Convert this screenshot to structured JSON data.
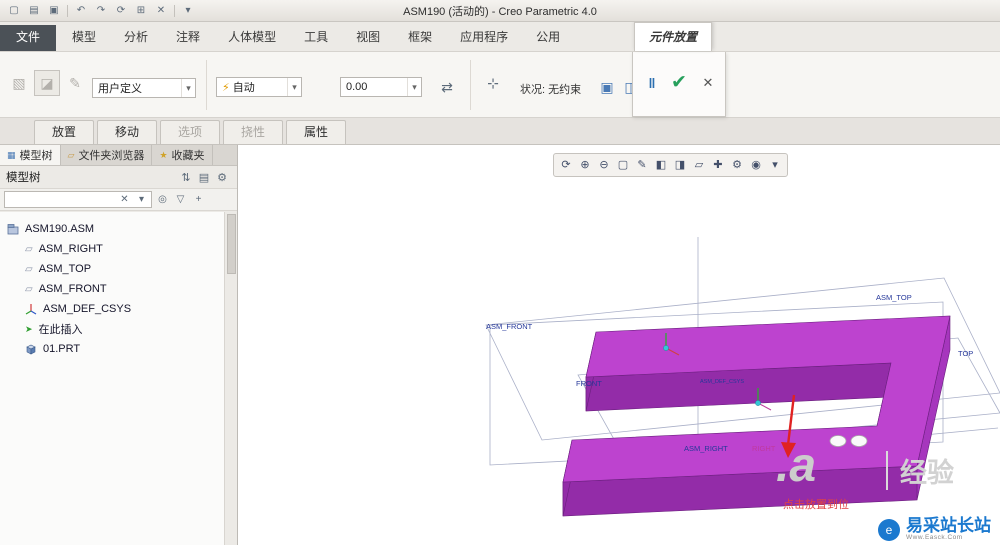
{
  "titlebar": {
    "title": "ASM190 (活动的) - Creo Parametric 4.0",
    "qat": [
      {
        "name": "new",
        "glyph": "▢"
      },
      {
        "name": "open",
        "glyph": "▤"
      },
      {
        "name": "save",
        "glyph": "▣"
      },
      {
        "name": "undo",
        "glyph": "↶"
      },
      {
        "name": "redo",
        "glyph": "↷"
      },
      {
        "name": "regenerate",
        "glyph": "⟳"
      },
      {
        "name": "window",
        "glyph": "⊞"
      },
      {
        "name": "close",
        "glyph": "✕"
      }
    ],
    "qat_more_glyph": "▾"
  },
  "ribbon_tabs": {
    "file": "文件",
    "items": [
      "模型",
      "分析",
      "注释",
      "人体模型",
      "工具",
      "视图",
      "框架",
      "应用程序",
      "公用"
    ],
    "contextual": "元件放置"
  },
  "ribbon": {
    "tools": [
      {
        "name": "interface-place",
        "glyph": "▧"
      },
      {
        "name": "manual-place",
        "glyph": "◪"
      },
      {
        "name": "edit-interface",
        "glyph": "✎"
      }
    ],
    "user_defined_value": "用户定义",
    "constraint": {
      "bolt_glyph": "⚡",
      "value": "自动"
    },
    "offset_value": "0.00",
    "flip_glyph": "⇄",
    "dragger_glyph": "⊹",
    "status_text": "状况: 无约束",
    "toggles": [
      {
        "name": "separate-window",
        "glyph": "▣"
      },
      {
        "name": "main-window",
        "glyph": "◫"
      }
    ],
    "pause_glyph": "‖",
    "confirm_glyph": "✔",
    "cancel_glyph": "✕"
  },
  "sub_tabs": [
    {
      "label": "放置"
    },
    {
      "label": "移动"
    },
    {
      "label": "选项"
    },
    {
      "label": "挠性"
    },
    {
      "label": "属性"
    }
  ],
  "left_panel": {
    "tabs": [
      {
        "label": "模型树",
        "icon": "model-tree"
      },
      {
        "label": "文件夹浏览器",
        "icon": "folder"
      },
      {
        "label": "收藏夹",
        "icon": "star"
      }
    ],
    "tab_icons": {
      "model_tree": "▦",
      "folder": "▱",
      "star": "★"
    },
    "header_title": "模型树",
    "header_icons": [
      {
        "name": "sort",
        "glyph": "⇅"
      },
      {
        "name": "list",
        "glyph": "▤"
      },
      {
        "name": "settings",
        "glyph": "⚙"
      }
    ],
    "filter": {
      "clear_glyph": "✕",
      "dropdown_glyph": "▾",
      "search_glyph": "◎",
      "filter_glyph": "▽",
      "add_glyph": "+"
    },
    "tree": [
      {
        "label": "ASM190.ASM",
        "icon": "assembly"
      },
      {
        "label": "ASM_RIGHT",
        "icon": "datum-plane"
      },
      {
        "label": "ASM_TOP",
        "icon": "datum-plane"
      },
      {
        "label": "ASM_FRONT",
        "icon": "datum-plane"
      },
      {
        "label": "ASM_DEF_CSYS",
        "icon": "csys"
      },
      {
        "label": "在此插入",
        "icon": "insert-here"
      },
      {
        "label": "01.PRT",
        "icon": "part"
      }
    ]
  },
  "graphics": {
    "toolbar": [
      {
        "name": "refresh",
        "glyph": "⟳"
      },
      {
        "name": "zoom-in",
        "glyph": "⊕"
      },
      {
        "name": "zoom-out",
        "glyph": "⊖"
      },
      {
        "name": "zoom-fit",
        "glyph": "▢"
      },
      {
        "name": "repaint",
        "glyph": "✎"
      },
      {
        "name": "display-style",
        "glyph": "◧"
      },
      {
        "name": "section",
        "glyph": "◨"
      },
      {
        "name": "datum-planes",
        "glyph": "▱"
      },
      {
        "name": "datum-axes",
        "glyph": "✚"
      },
      {
        "name": "view-manager",
        "glyph": "⚙"
      },
      {
        "name": "spin-center",
        "glyph": "◉"
      },
      {
        "name": "more",
        "glyph": "▾"
      }
    ],
    "labels": {
      "asm_top": "ASM_TOP",
      "asm_front": "ASM_FRONT",
      "asm_right": "ASM_RIGHT",
      "top": "TOP",
      "front": "FRONT",
      "right": "RIGHT",
      "csys": "ASM_DEF_CSYS"
    },
    "colors": {
      "part_top": "#bd43cf",
      "part_front": "#932ca8",
      "part_side": "#a636bd",
      "part_inner": "#7e2596",
      "label_blue": "#26389a",
      "label_magenta": "#c0399f",
      "arrow_red": "#e02222"
    },
    "annotation_red": "点击放置到位",
    "watermark": {
      "a_text": ".a",
      "jingyan": "经验",
      "site_name": "易采站长站",
      "site_sub": "Www.Easck.Com"
    }
  }
}
